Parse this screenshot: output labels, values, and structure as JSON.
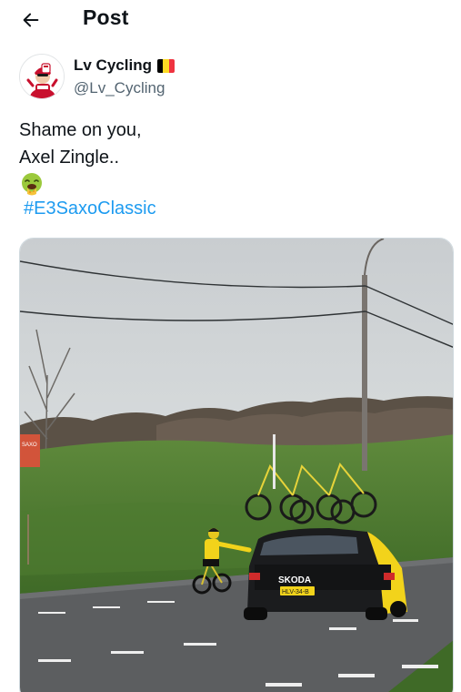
{
  "header": {
    "title": "Post",
    "back_icon": "arrow-left-icon"
  },
  "author": {
    "name": "Lv Cycling",
    "handle": "@Lv_Cycling",
    "flag": "belgium-flag-icon",
    "flag_colors": [
      "#000000",
      "#FDDA24",
      "#EF3340"
    ]
  },
  "post": {
    "lines": [
      "Shame on you,",
      "Axel Zingle.."
    ],
    "emoji": "face-vomiting-emoji",
    "hashtag": "#E3SaxoClassic"
  },
  "media": {
    "type": "video",
    "car_brand": "SKODA",
    "license_plate": "HLV-34-B",
    "roadside_sign": "SAXO"
  },
  "colors": {
    "link": "#1d9bf0",
    "secondary_text": "#536471",
    "primary_text": "#0f1419",
    "team_yellow": "#f2d31b"
  }
}
